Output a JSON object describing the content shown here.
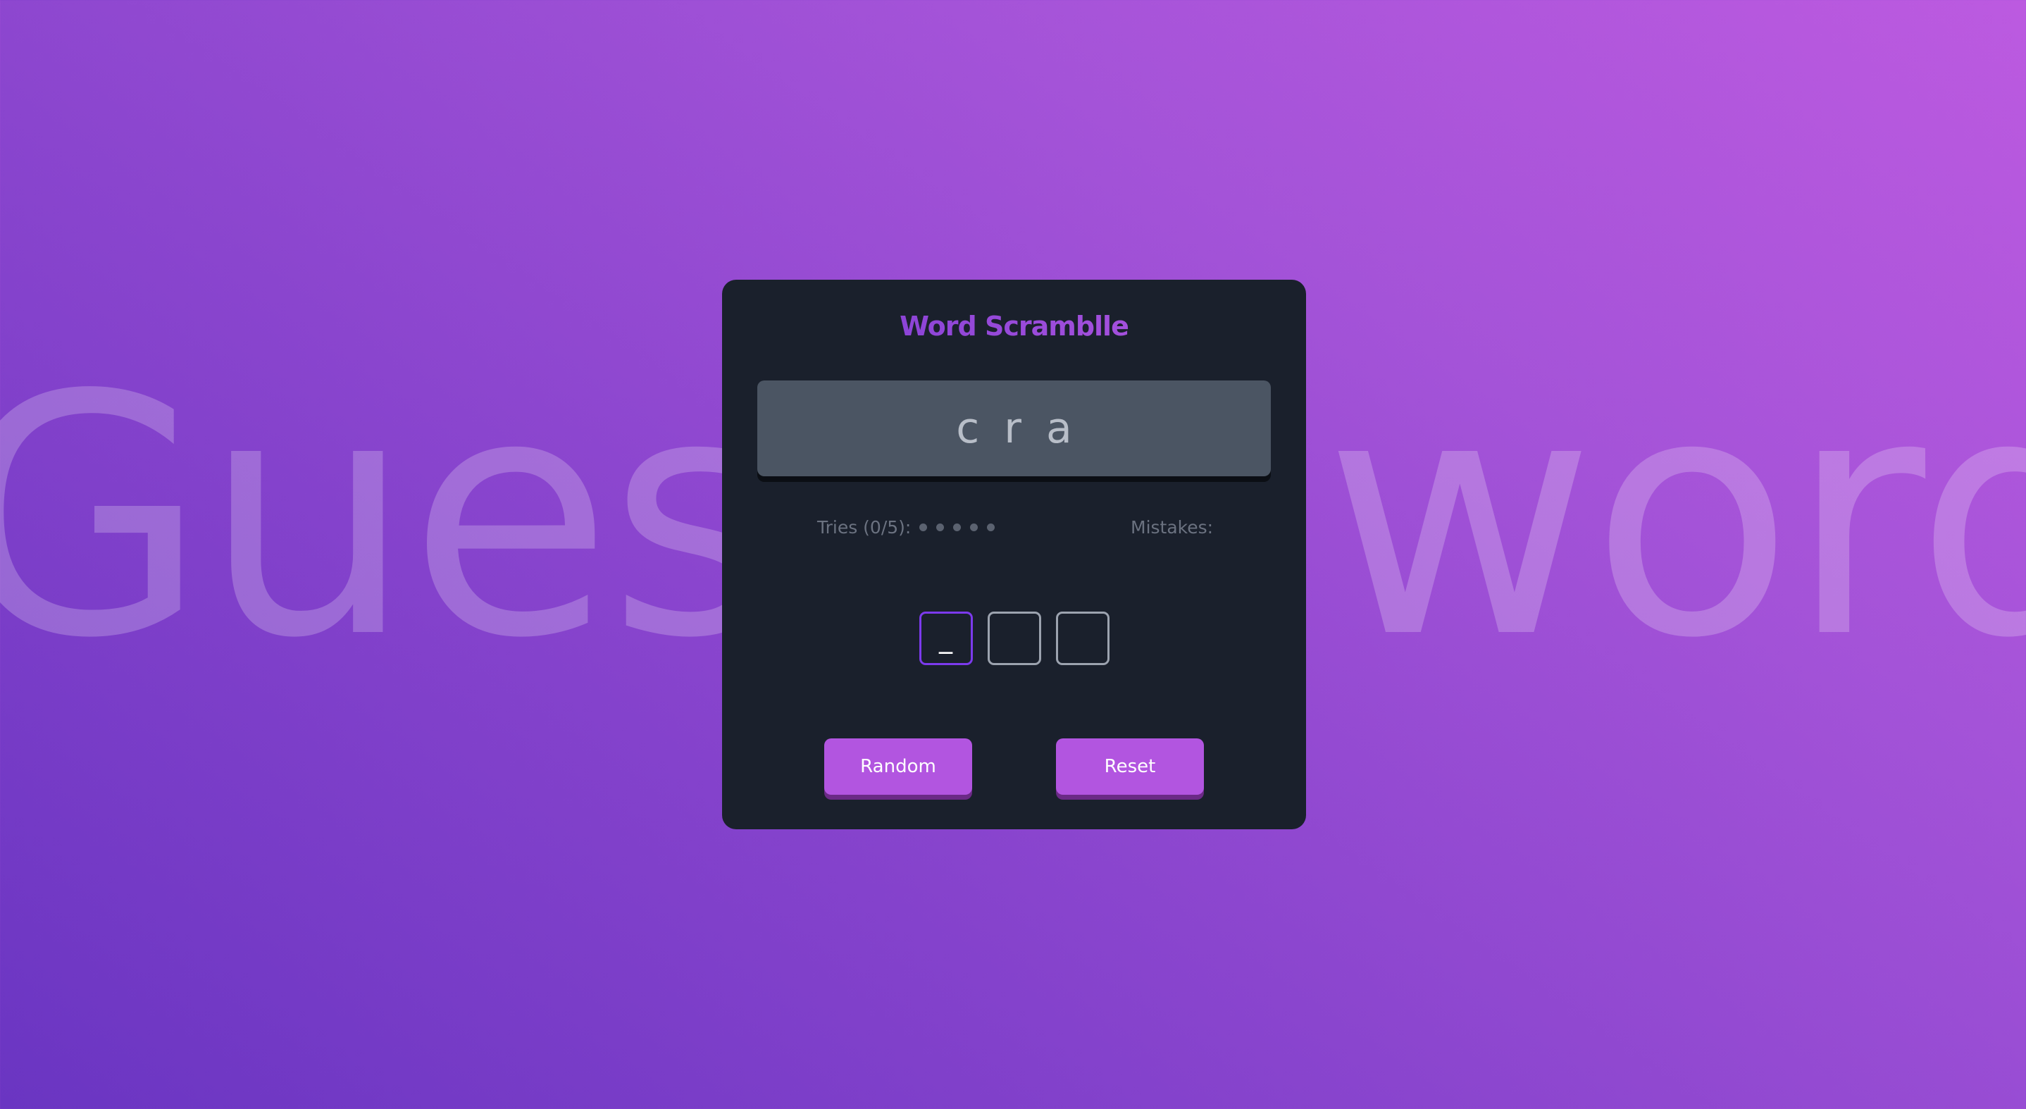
{
  "background": {
    "left_word": "Guess",
    "right_word": "word"
  },
  "card": {
    "title": "Word Scramblle",
    "scrambled_word": "c r a",
    "tries_label": "Tries (0/5):",
    "tries_used": 0,
    "tries_max": 5,
    "mistakes_label": "Mistakes:",
    "slots": [
      "_",
      "",
      ""
    ],
    "random_label": "Random",
    "reset_label": "Reset"
  },
  "colors": {
    "accent": "#b255e0",
    "title_gradient_start": "#7a3bd3",
    "card_background": "#1a202c",
    "scramble_box": "#4b5563",
    "active_slot_border": "#7c3aed"
  }
}
